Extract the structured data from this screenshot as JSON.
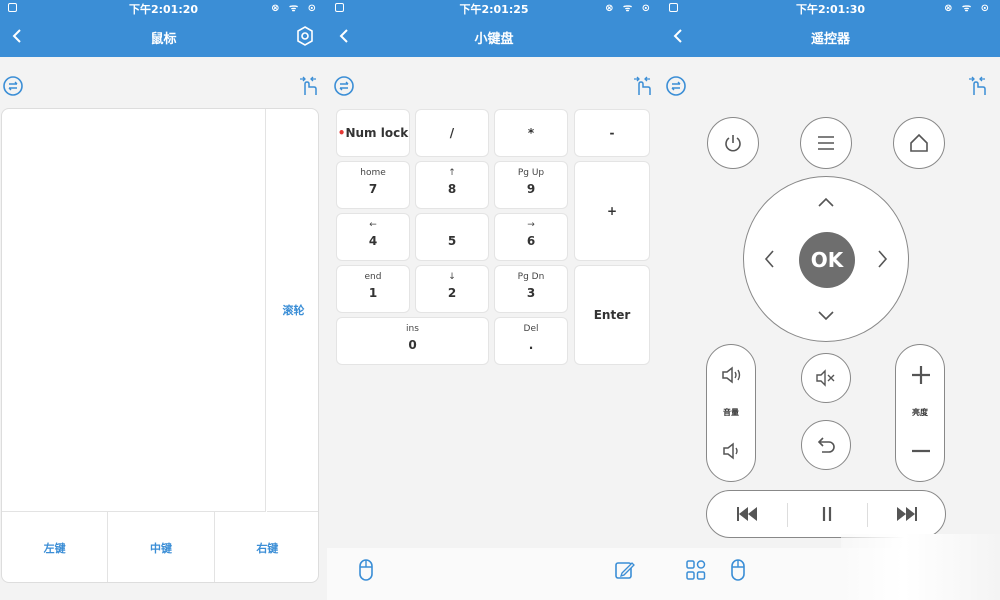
{
  "screens": [
    {
      "time": "下午2:01:20",
      "title": "鼠标"
    },
    {
      "time": "下午2:01:25",
      "title": "小键盘"
    },
    {
      "time": "下午2:01:30",
      "title": "遥控器"
    }
  ],
  "status_icons": "⊗ ᯤ ⊙",
  "mouse": {
    "wheel_label": "滚轮",
    "left_button": "左键",
    "middle_button": "中键",
    "right_button": "右键"
  },
  "keypad": {
    "numlock": "Num lock",
    "numlock_dot": "•",
    "slash": "/",
    "star": "*",
    "minus": "-",
    "plus": "+",
    "enter": "Enter",
    "k7": {
      "sub": "home",
      "main": "7"
    },
    "k8": {
      "sub": "↑",
      "main": "8"
    },
    "k9": {
      "sub": "Pg Up",
      "main": "9"
    },
    "k4": {
      "sub": "←",
      "main": "4"
    },
    "k5": {
      "main": "5"
    },
    "k6": {
      "sub": "→",
      "main": "6"
    },
    "k1": {
      "sub": "end",
      "main": "1"
    },
    "k2": {
      "sub": "↓",
      "main": "2"
    },
    "k3": {
      "sub": "Pg Dn",
      "main": "3"
    },
    "k0": {
      "sub": "ins",
      "main": "0"
    },
    "kdot": {
      "sub": "Del",
      "main": "."
    }
  },
  "remote": {
    "ok_label": "OK",
    "volume_label": "音量",
    "brightness_label": "亮度"
  },
  "colors": {
    "accent": "#3b8ed6",
    "ok_button": "#6e6e6e",
    "numlock_dot": "#e53935"
  }
}
